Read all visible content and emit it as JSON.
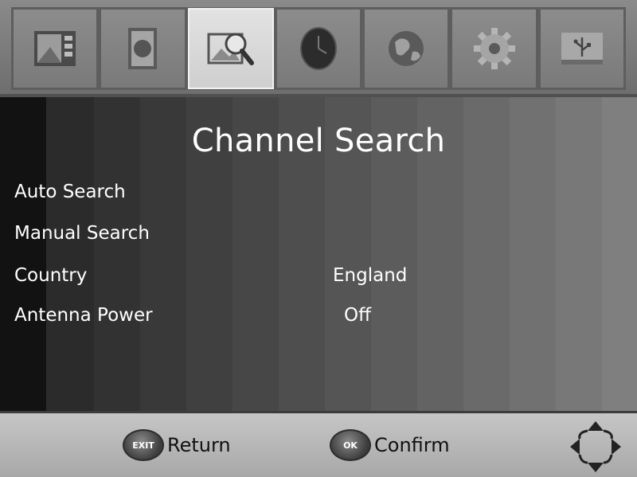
{
  "menu_tabs": [
    {
      "icon": "picture-icon",
      "active": false
    },
    {
      "icon": "image-icon",
      "active": false
    },
    {
      "icon": "channel-search-icon",
      "active": true
    },
    {
      "icon": "clock-icon",
      "active": false
    },
    {
      "icon": "globe-icon",
      "active": false
    },
    {
      "icon": "gear-icon",
      "active": false
    },
    {
      "icon": "usb-icon",
      "active": false
    }
  ],
  "page": {
    "title": "Channel Search"
  },
  "menu": {
    "auto_search": {
      "label": "Auto Search"
    },
    "manual_search": {
      "label": "Manual Search"
    },
    "country": {
      "label": "Country",
      "value": "England"
    },
    "antenna_power": {
      "label": "Antenna Power",
      "value": "Off"
    }
  },
  "footer": {
    "exit_key": "EXIT",
    "return_label": "Return",
    "ok_key": "OK",
    "confirm_label": "Confirm"
  },
  "colors": {
    "menu_text": "#ffffff",
    "active_tab": "#d8d8d8",
    "footer_bg": "#b8b8b8"
  }
}
